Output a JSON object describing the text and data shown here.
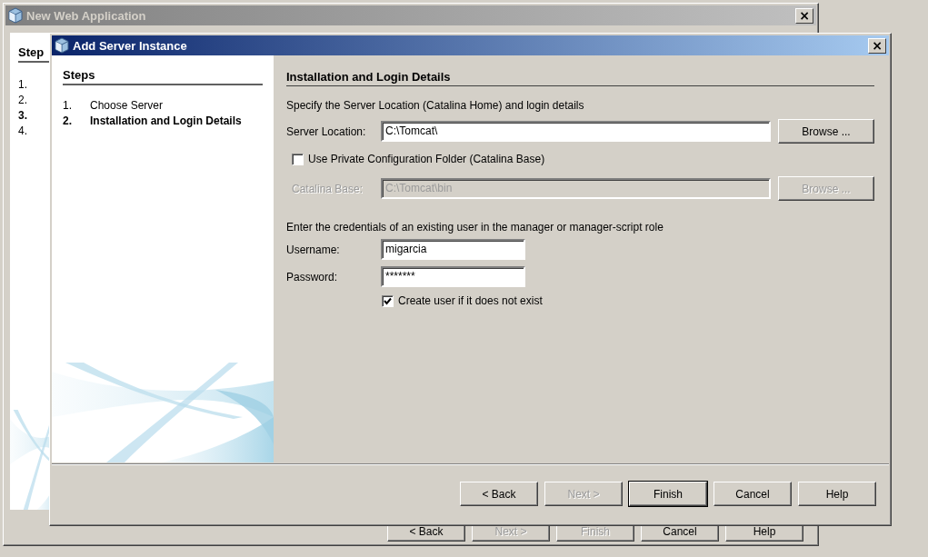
{
  "background_window": {
    "title": "New Web Application",
    "active": false,
    "close": "×",
    "steps_heading": "Step",
    "steps": [
      {
        "number": "1.",
        "current": false
      },
      {
        "number": "2.",
        "current": false
      },
      {
        "number": "3.",
        "current": true
      },
      {
        "number": "4.",
        "current": false
      }
    ],
    "buttons": [
      {
        "label": "< Back",
        "disabled": false,
        "default": false
      },
      {
        "label": "Next >",
        "disabled": true,
        "default": false
      },
      {
        "label": "Finish",
        "disabled": true,
        "default": false
      },
      {
        "label": "Cancel",
        "disabled": false,
        "default": false
      },
      {
        "label": "Help",
        "disabled": false,
        "default": false
      }
    ]
  },
  "dialog": {
    "title": "Add Server Instance",
    "active": true,
    "close": "×",
    "steps_heading": "Steps",
    "steps": [
      {
        "number": "1.",
        "label": "Choose Server",
        "current": false
      },
      {
        "number": "2.",
        "label": "Installation and Login Details",
        "current": true
      }
    ],
    "section_title": "Installation and Login Details",
    "intro": "Specify the Server Location (Catalina Home) and login details",
    "server_location": {
      "label": "Server Location:",
      "value": "C:\\Tomcat\\",
      "button": "Browse ...",
      "disabled": false
    },
    "private_config": {
      "label": "Use Private Configuration Folder (Catalina Base)",
      "checked": false
    },
    "catalina_base": {
      "label": "Catalina Base:",
      "value": "C:\\Tomcat\\bin",
      "button": "Browse ...",
      "disabled": true
    },
    "credentials_text": "Enter the credentials of an existing user in the manager or manager-script role",
    "username": {
      "label": "Username:",
      "value": "migarcia"
    },
    "password": {
      "label": "Password:",
      "value": "*******"
    },
    "create_user": {
      "label": "Create user if it does not exist",
      "checked": true
    },
    "buttons": [
      {
        "label": "< Back",
        "disabled": false,
        "default": false
      },
      {
        "label": "Next >",
        "disabled": true,
        "default": false
      },
      {
        "label": "Finish",
        "disabled": false,
        "default": true
      },
      {
        "label": "Cancel",
        "disabled": false,
        "default": false
      },
      {
        "label": "Help",
        "disabled": false,
        "default": false
      }
    ]
  }
}
